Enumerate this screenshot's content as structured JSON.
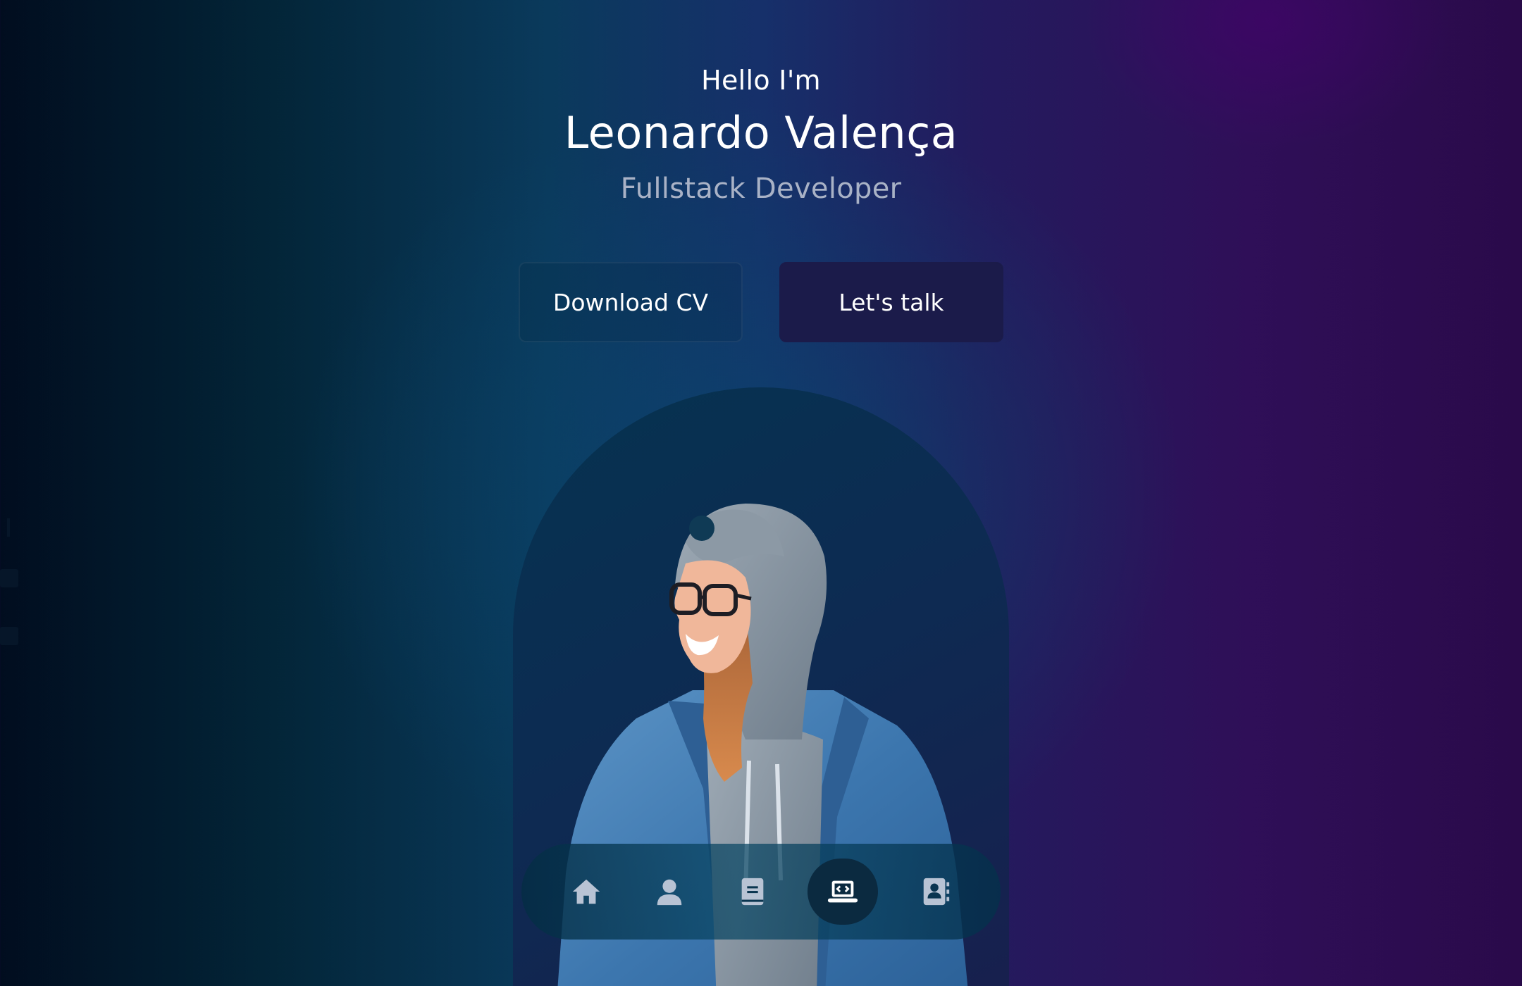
{
  "hero": {
    "greeting": "Hello I'm",
    "name": "Leonardo Valença",
    "role": "Fullstack Developer"
  },
  "buttons": {
    "download_cv": "Download CV",
    "lets_talk": "Let's talk"
  },
  "colors": {
    "primary_button": "#1b1b4a",
    "subtitle": "#a9b2c6",
    "nav_active": "#0b2a40",
    "nav_icon": "#b8c3d4"
  },
  "nav": {
    "items": [
      {
        "icon": "home-icon",
        "active": false
      },
      {
        "icon": "user-icon",
        "active": false
      },
      {
        "icon": "book-icon",
        "active": false
      },
      {
        "icon": "laptop-code-icon",
        "active": true
      },
      {
        "icon": "contact-book-icon",
        "active": false
      }
    ]
  },
  "portrait": {
    "icon": "person-portrait-image"
  }
}
